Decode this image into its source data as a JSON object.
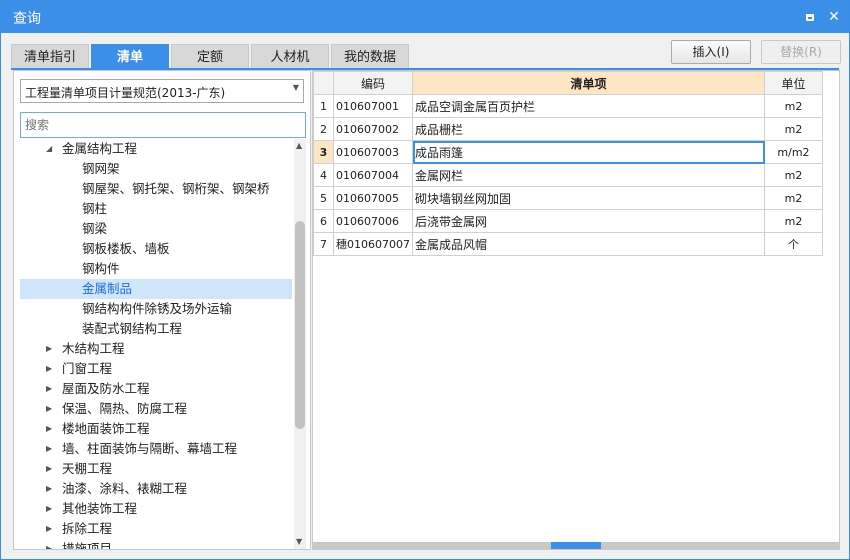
{
  "window": {
    "title": "查询"
  },
  "tabs": [
    {
      "label": "清单指引"
    },
    {
      "label": "清单"
    },
    {
      "label": "定额"
    },
    {
      "label": "人材机"
    },
    {
      "label": "我的数据"
    }
  ],
  "buttons": {
    "insert": "插入(I)",
    "replace": "替换(R)"
  },
  "left": {
    "spec_select": "工程量清单项目计量规范(2013-广东)",
    "search_placeholder": "搜索",
    "tree": [
      {
        "label": "金属结构工程",
        "level": 1,
        "expander": "expanded"
      },
      {
        "label": "钢网架",
        "level": 2
      },
      {
        "label": "钢屋架、钢托架、钢桁架、钢架桥",
        "level": 2
      },
      {
        "label": "钢柱",
        "level": 2
      },
      {
        "label": "钢梁",
        "level": 2
      },
      {
        "label": "钢板楼板、墙板",
        "level": 2
      },
      {
        "label": "钢构件",
        "level": 2
      },
      {
        "label": "金属制品",
        "level": 2,
        "selected": true
      },
      {
        "label": "钢结构构件除锈及场外运输",
        "level": 2
      },
      {
        "label": "装配式钢结构工程",
        "level": 2
      },
      {
        "label": "木结构工程",
        "level": 1,
        "expander": "collapsed"
      },
      {
        "label": "门窗工程",
        "level": 1,
        "expander": "collapsed"
      },
      {
        "label": "屋面及防水工程",
        "level": 1,
        "expander": "collapsed"
      },
      {
        "label": "保温、隔热、防腐工程",
        "level": 1,
        "expander": "collapsed"
      },
      {
        "label": "楼地面装饰工程",
        "level": 1,
        "expander": "collapsed"
      },
      {
        "label": "墙、柱面装饰与隔断、幕墙工程",
        "level": 1,
        "expander": "collapsed"
      },
      {
        "label": "天棚工程",
        "level": 1,
        "expander": "collapsed"
      },
      {
        "label": "油漆、涂料、裱糊工程",
        "level": 1,
        "expander": "collapsed"
      },
      {
        "label": "其他装饰工程",
        "level": 1,
        "expander": "collapsed"
      },
      {
        "label": "拆除工程",
        "level": 1,
        "expander": "collapsed"
      },
      {
        "label": "措施项目",
        "level": 1,
        "expander": "collapsed"
      }
    ]
  },
  "grid": {
    "headers": {
      "num": "",
      "code": "编码",
      "item": "清单项",
      "unit": "单位"
    },
    "rows": [
      {
        "num": "1",
        "code": "010607001",
        "item": "成品空调金属百页护栏",
        "unit": "m2"
      },
      {
        "num": "2",
        "code": "010607002",
        "item": "成品栅栏",
        "unit": "m2"
      },
      {
        "num": "3",
        "code": "010607003",
        "item": "成品雨篷",
        "unit": "m/m2",
        "current": true
      },
      {
        "num": "4",
        "code": "010607004",
        "item": "金属网栏",
        "unit": "m2"
      },
      {
        "num": "5",
        "code": "010607005",
        "item": "砌块墙钢丝网加固",
        "unit": "m2"
      },
      {
        "num": "6",
        "code": "010607006",
        "item": "后浇带金属网",
        "unit": "m2"
      },
      {
        "num": "7",
        "code": "穗010607007",
        "item": "金属成品风帽",
        "unit": "个"
      }
    ]
  },
  "icons": {
    "maximize": "maximize-icon",
    "close": "close-icon",
    "expanded": "triangle-down-icon",
    "collapsed": "triangle-right-icon"
  },
  "colors": {
    "accent": "#3b8fe8",
    "selection": "#cfe5fb",
    "header_highlight": "#fde6c4"
  }
}
